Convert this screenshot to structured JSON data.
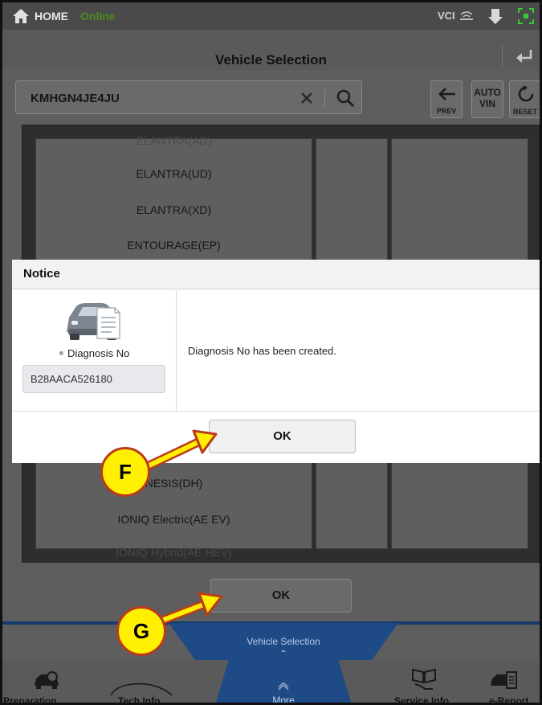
{
  "statusbar": {
    "home": "HOME",
    "status": "Online",
    "vci": "VCI"
  },
  "header": {
    "title": "Vehicle Selection"
  },
  "search": {
    "value": "KMHGN4JE4JU"
  },
  "tools": {
    "prev": "PREV",
    "auto_vin_line1": "AUTO",
    "auto_vin_line2": "VIN",
    "reset": "RESET"
  },
  "models": {
    "partial_top": "ELANTRA(AD)",
    "items": [
      "ELANTRA(UD)",
      "ELANTRA(XD)",
      "ENTOURAGE(EP)"
    ],
    "below_dialog": [
      "NESIS(DH)",
      "IONIQ Electric(AE EV)"
    ],
    "partial_bottom": "IONIQ Hybrid(AE HEV)"
  },
  "dialog": {
    "title": "Notice",
    "diag_label": "Diagnosis No",
    "diag_value": "B28AACA526180",
    "message": "Diagnosis No has been created.",
    "ok": "OK"
  },
  "bottom": {
    "ok": "OK",
    "tab_label": "Vehicle Selection",
    "more": "More",
    "nav": [
      "Preparation",
      "Tech Info",
      "Service Info.",
      "e-Report"
    ]
  },
  "annotations": {
    "f": "F",
    "g": "G"
  },
  "colors": {
    "accent_online": "#4d8a1f",
    "nav_blue": "#1e4b86",
    "callout_fill": "#ffef00",
    "callout_border": "#b93b1d"
  }
}
